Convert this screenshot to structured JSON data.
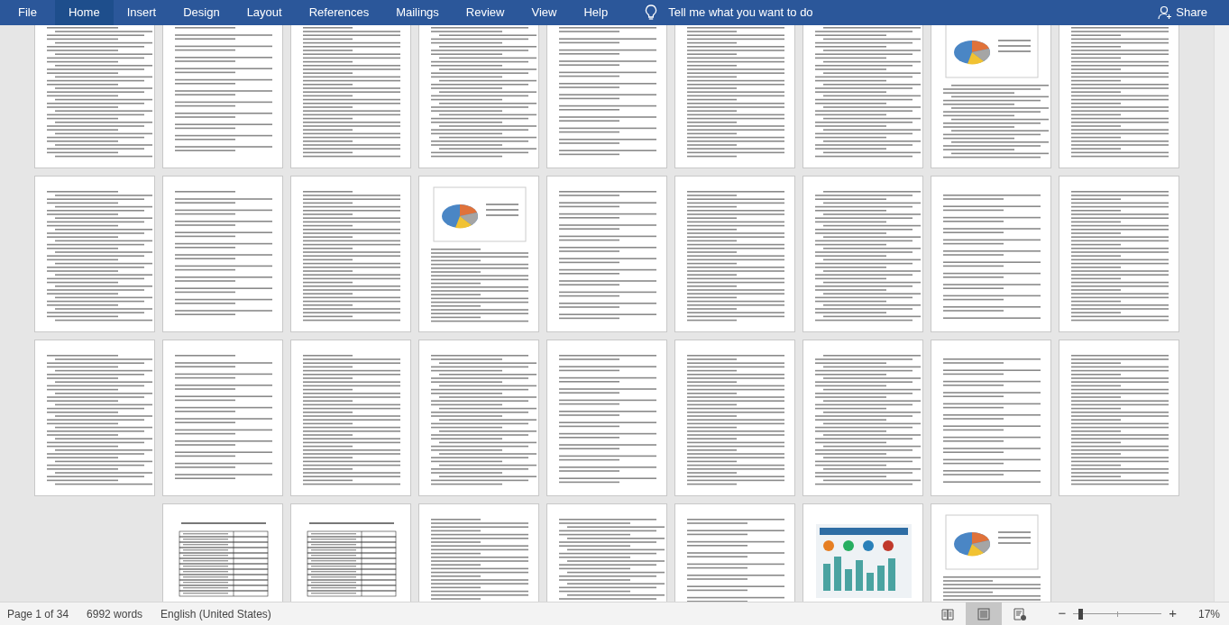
{
  "ribbon": {
    "tabs": [
      {
        "label": "File",
        "selected": false
      },
      {
        "label": "Home",
        "selected": true
      },
      {
        "label": "Insert",
        "selected": false
      },
      {
        "label": "Design",
        "selected": false
      },
      {
        "label": "Layout",
        "selected": false
      },
      {
        "label": "References",
        "selected": false
      },
      {
        "label": "Mailings",
        "selected": false
      },
      {
        "label": "Review",
        "selected": false
      },
      {
        "label": "View",
        "selected": false
      },
      {
        "label": "Help",
        "selected": false
      }
    ],
    "tell_me": "Tell me what you want to do",
    "share": "Share"
  },
  "pages": [
    {
      "kind": "text"
    },
    {
      "kind": "text"
    },
    {
      "kind": "text"
    },
    {
      "kind": "text"
    },
    {
      "kind": "text"
    },
    {
      "kind": "text"
    },
    {
      "kind": "text"
    },
    {
      "kind": "chart"
    },
    {
      "kind": "text"
    },
    {
      "kind": "text"
    },
    {
      "kind": "text"
    },
    {
      "kind": "text"
    },
    {
      "kind": "chart"
    },
    {
      "kind": "text"
    },
    {
      "kind": "text"
    },
    {
      "kind": "text"
    },
    {
      "kind": "text"
    },
    {
      "kind": "text"
    },
    {
      "kind": "text"
    },
    {
      "kind": "text"
    },
    {
      "kind": "text"
    },
    {
      "kind": "text"
    },
    {
      "kind": "text"
    },
    {
      "kind": "text"
    },
    {
      "kind": "text"
    },
    {
      "kind": "text"
    },
    {
      "kind": "text"
    },
    {
      "kind": "table"
    },
    {
      "kind": "table"
    },
    {
      "kind": "text"
    },
    {
      "kind": "text"
    },
    {
      "kind": "text"
    },
    {
      "kind": "infographic"
    },
    {
      "kind": "chart"
    }
  ],
  "status_bar": {
    "page": "Page 1 of 34",
    "words": "6992 words",
    "language": "English (United States)",
    "views": [
      {
        "kind": "read",
        "selected": false
      },
      {
        "kind": "print",
        "selected": true
      },
      {
        "kind": "web",
        "selected": false
      }
    ],
    "zoom": {
      "minus": "−",
      "plus": "+",
      "level": 0.06,
      "reading": "17%"
    }
  }
}
